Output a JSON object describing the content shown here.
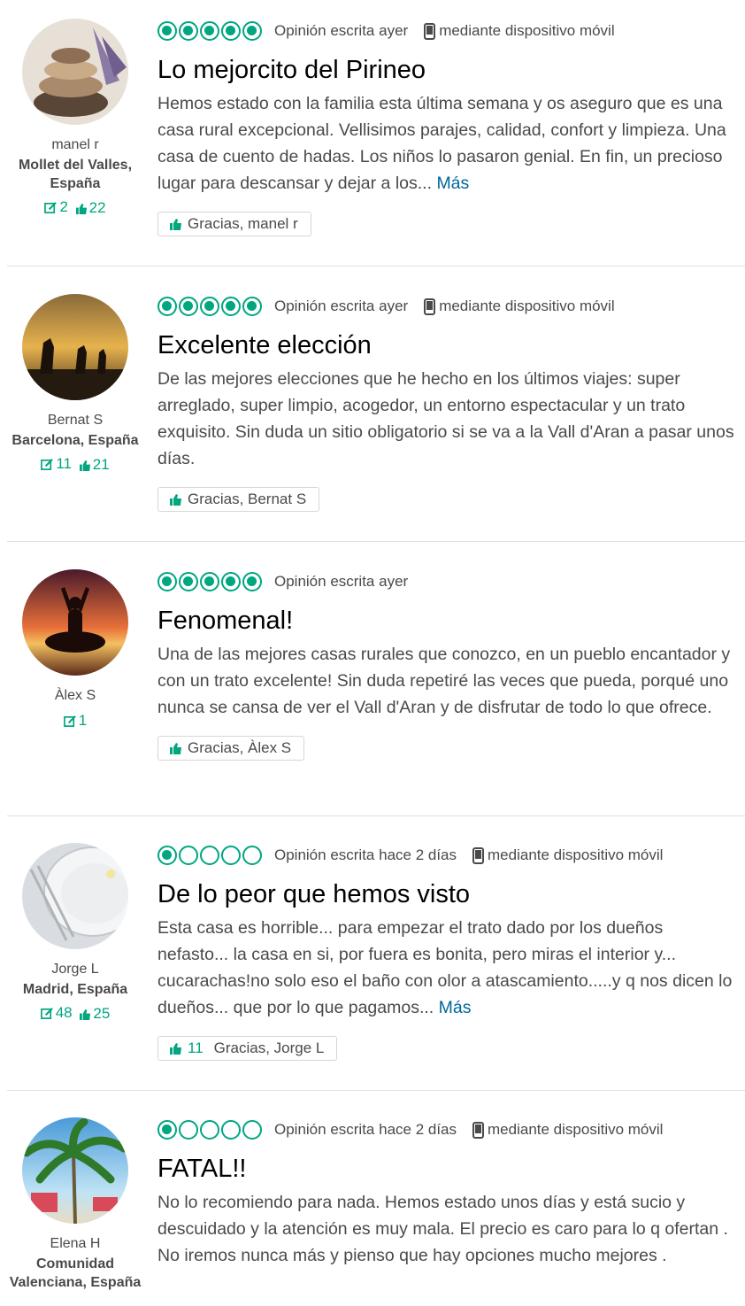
{
  "reviews": [
    {
      "member": {
        "name": "manel r",
        "location": "Mollet del Valles, España",
        "reviews": "2",
        "helpful": "22"
      },
      "rating": 5,
      "date": "Opinión escrita ayer",
      "mobile": "mediante dispositivo móvil",
      "title": "Lo mejorcito del Pirineo",
      "body": "Hemos estado con la familia esta última semana y os aseguro que es una casa rural excepcional. Vellisimos parajes, calidad, confort y limpieza. Una casa de cuento de hadas. Los niños lo pasaron genial. En fin, un precioso lugar para descansar y dejar a los...",
      "more": "Más",
      "thanks": "Gracias, manel r",
      "thanks_count": ""
    },
    {
      "member": {
        "name": "Bernat S",
        "location": "Barcelona, España",
        "reviews": "11",
        "helpful": "21"
      },
      "rating": 5,
      "date": "Opinión escrita ayer",
      "mobile": "mediante dispositivo móvil",
      "title": "Excelente elección",
      "body": "De las mejores elecciones que he hecho en los últimos viajes: super arreglado, super limpio, acogedor, un entorno espectacular y un trato exquisito. Sin duda un sitio obligatorio si se va a la Vall d'Aran a pasar unos días.",
      "more": "",
      "thanks": "Gracias, Bernat S",
      "thanks_count": ""
    },
    {
      "member": {
        "name": "Àlex S",
        "location": "",
        "reviews": "1",
        "helpful": ""
      },
      "rating": 5,
      "date": "Opinión escrita ayer",
      "mobile": "",
      "title": "Fenomenal!",
      "body": "Una de las mejores casas rurales que conozco, en un pueblo encantador y con un trato excelente! Sin duda repetiré las veces que pueda, porqué uno nunca se cansa de ver el Vall d'Aran y de disfrutar de todo lo que ofrece.",
      "more": "",
      "thanks": "Gracias, Àlex S",
      "thanks_count": ""
    },
    {
      "member": {
        "name": "Jorge L",
        "location": "Madrid, España",
        "reviews": "48",
        "helpful": "25"
      },
      "rating": 1,
      "date": "Opinión escrita hace 2 días",
      "mobile": "mediante dispositivo móvil",
      "title": "De lo peor que hemos visto",
      "body": "Esta casa es horrible... para empezar el trato dado por los dueños nefasto... la casa en si, por fuera es bonita, pero miras el interior y... cucarachas!no solo eso el baño con olor a atascamiento.....y q nos dicen lo dueños... que por lo que pagamos...",
      "more": "Más",
      "thanks": "Gracias, Jorge L",
      "thanks_count": "11"
    },
    {
      "member": {
        "name": "Elena H",
        "location": "Comunidad Valenciana, España",
        "reviews": "",
        "helpful": ""
      },
      "rating": 1,
      "date": "Opinión escrita hace 2 días",
      "mobile": "mediante dispositivo móvil",
      "title": "FATAL!!",
      "body": "No lo recomiendo para nada. Hemos estado unos días y está sucio y descuidado y la atención es muy mala. El precio es caro para lo q ofertan . No iremos nunca más y pienso que hay opciones mucho mejores .",
      "more": "",
      "thanks": "",
      "thanks_count": ""
    }
  ],
  "colors": {
    "accent": "#00a680",
    "link": "#006699"
  },
  "icons": [
    "pencil-icon",
    "thumbs-up-icon",
    "mobile-phone-icon",
    "rating-bubble-icon"
  ]
}
